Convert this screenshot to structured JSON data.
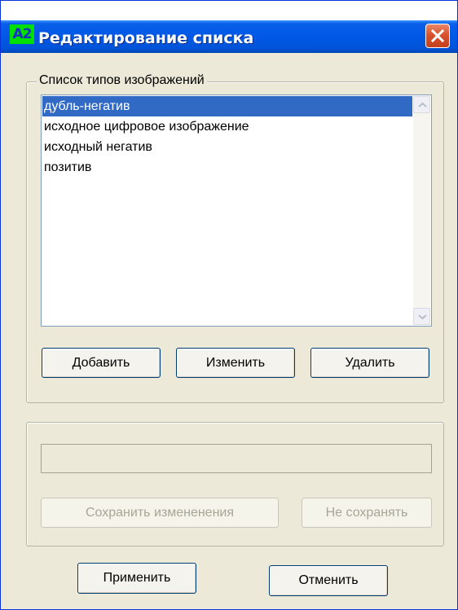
{
  "window": {
    "icon_text": "A2",
    "title": "Редактирование списка"
  },
  "group_list": {
    "legend": "Список типов изображений",
    "items": [
      {
        "label": "дубль-негатив",
        "selected": true
      },
      {
        "label": "исходное цифровое изображение",
        "selected": false
      },
      {
        "label": "исходный негатив",
        "selected": false
      },
      {
        "label": "позитив",
        "selected": false
      }
    ],
    "add_label": "Добавить",
    "edit_label": "Изменить",
    "delete_label": "Удалить"
  },
  "group_edit": {
    "input_value": "",
    "save_label": "Сохранить измененения",
    "nosave_label": "Не сохранять"
  },
  "footer": {
    "apply_label": "Применить",
    "cancel_label": "Отменить"
  },
  "colors": {
    "selection": "#316ac5",
    "titlebar": "#0058e6",
    "face": "#ece9d8",
    "close": "#d9532c"
  }
}
